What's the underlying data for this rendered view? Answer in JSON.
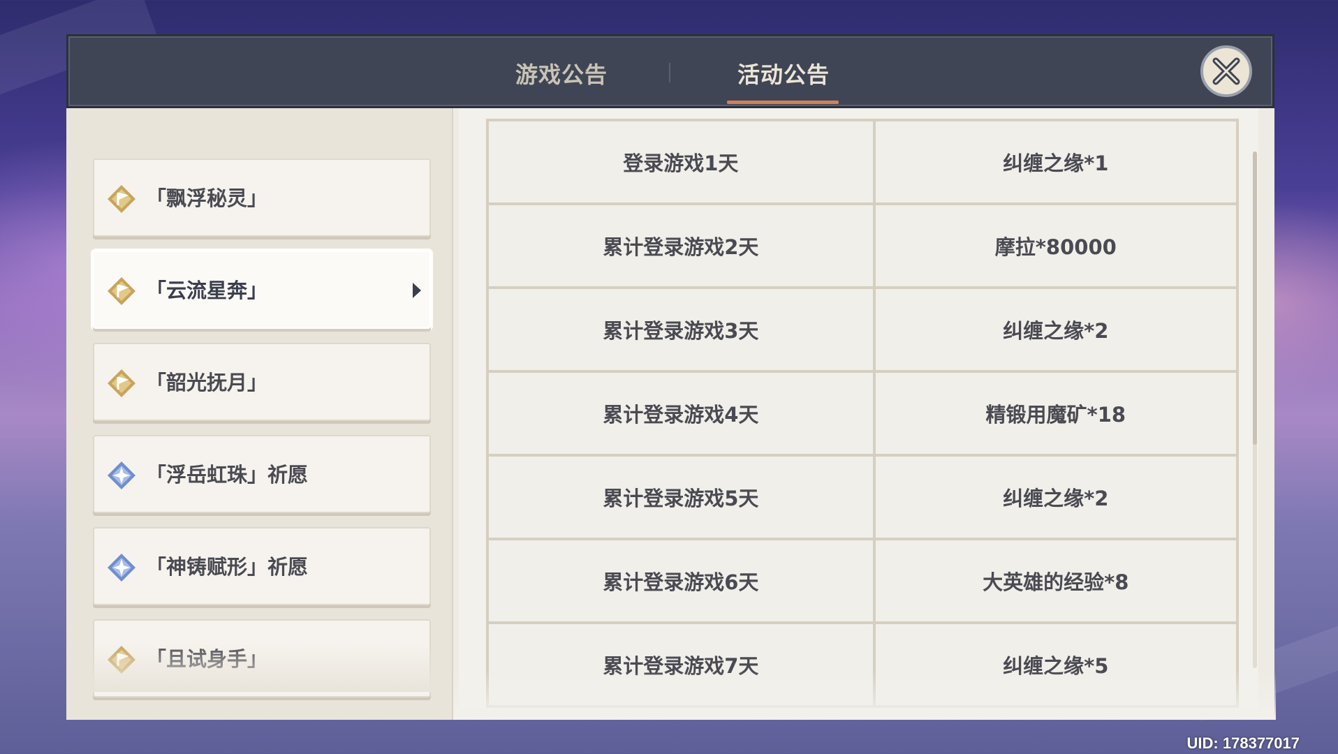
{
  "tabs": {
    "game_notice": "游戏公告",
    "event_notice": "活动公告",
    "active_tab": "event_notice"
  },
  "sidebar": {
    "items": [
      {
        "label": "「飘浮秘灵」",
        "icon": "event-flag-icon",
        "active": false
      },
      {
        "label": "「云流星奔」",
        "icon": "event-flag-icon",
        "active": true
      },
      {
        "label": "「韶光抚月」",
        "icon": "event-flag-icon",
        "active": false
      },
      {
        "label": "「浮岳虹珠」祈愿",
        "icon": "wish-star-icon",
        "active": false
      },
      {
        "label": "「神铸赋形」祈愿",
        "icon": "wish-star-icon",
        "active": false
      },
      {
        "label": "「且试身手」",
        "icon": "event-flag-icon",
        "active": false
      }
    ]
  },
  "rewards_table": {
    "rows": [
      {
        "condition": "登录游戏1天",
        "reward": "纠缠之缘*1"
      },
      {
        "condition": "累计登录游戏2天",
        "reward": "摩拉*80000"
      },
      {
        "condition": "累计登录游戏3天",
        "reward": "纠缠之缘*2"
      },
      {
        "condition": "累计登录游戏4天",
        "reward": "精锻用魔矿*18"
      },
      {
        "condition": "累计登录游戏5天",
        "reward": "纠缠之缘*2"
      },
      {
        "condition": "累计登录游戏6天",
        "reward": "大英雄的经验*8"
      },
      {
        "condition": "累计登录游戏7天",
        "reward": "纠缠之缘*5"
      }
    ]
  },
  "uid": "UID: 178377017",
  "colors": {
    "header_bg": "#3f4554",
    "tab_underline": "#d3805a",
    "event_icon": "#c9a45a",
    "wish_icon": "#6f8ed0"
  }
}
